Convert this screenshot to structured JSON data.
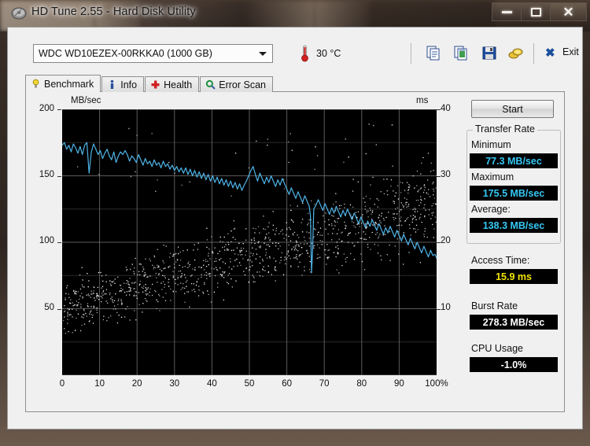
{
  "window": {
    "title": "HD Tune 2.55 - Hard Disk Utility",
    "icon": "hard-disk-icon",
    "controls": {
      "minimize": "–",
      "maximize": "□",
      "close": "✕"
    }
  },
  "toolbar": {
    "drive": "WDC WD10EZEX-00RKKA0 (1000 GB)",
    "temperature": "30 °C",
    "thermometer_icon": "thermometer-icon",
    "icons": [
      {
        "name": "copy-icon"
      },
      {
        "name": "copy-screenshot-icon"
      },
      {
        "name": "save-icon"
      },
      {
        "name": "gold-coins-icon"
      }
    ],
    "exit_label": "Exit",
    "exit_icon": "close-x-icon"
  },
  "tabs": [
    {
      "label": "Benchmark",
      "icon": "bulb-icon",
      "active": true
    },
    {
      "label": "Info",
      "icon": "info-icon",
      "active": false
    },
    {
      "label": "Health",
      "icon": "health-cross-icon",
      "active": false
    },
    {
      "label": "Error Scan",
      "icon": "magnifier-icon",
      "active": false
    }
  ],
  "results": {
    "start_label": "Start",
    "transfer_group": "Transfer Rate",
    "minimum_label": "Minimum",
    "minimum_value": "77.3 MB/sec",
    "maximum_label": "Maximum",
    "maximum_value": "175.5 MB/sec",
    "average_label": "Average:",
    "average_value": "138.3 MB/sec",
    "access_label": "Access Time:",
    "access_value": "15.9 ms",
    "burst_label": "Burst Rate",
    "burst_value": "278.3 MB/sec",
    "cpu_label": "CPU Usage",
    "cpu_value": "-1.0%"
  },
  "colors": {
    "transfer_line": "#4fb4e8",
    "access_dots": "#ffffff",
    "plot_bg": "#000000",
    "grid": "#7a7a7a",
    "value_cyan": "#36c8f4",
    "value_yellow": "#f2e500",
    "value_white": "#ffffff"
  },
  "chart_data": {
    "type": "line",
    "title": "",
    "xlabel": "",
    "ylabel": "MB/sec",
    "y2label": "ms",
    "xlim": [
      0,
      100
    ],
    "ylim": [
      0,
      200
    ],
    "y2lim": [
      0,
      40
    ],
    "grid": true,
    "legend": "none",
    "x_ticks": [
      "0",
      "10",
      "20",
      "30",
      "40",
      "50",
      "60",
      "70",
      "80",
      "90",
      "100%"
    ],
    "y_ticks_left": [
      "200",
      "150",
      "100",
      "50"
    ],
    "y_ticks_right": [
      "40",
      "30",
      "20",
      "10"
    ],
    "series": [
      {
        "name": "Transfer rate",
        "axis": "left",
        "unit": "MB/sec",
        "color": "#4fb4e8",
        "x": [
          0,
          0.6,
          1.2,
          1.8,
          2.4,
          3,
          3.6,
          4.2,
          4.8,
          5.4,
          6,
          6.6,
          7.2,
          7.8,
          8.4,
          9,
          9.6,
          10.2,
          10.8,
          11.4,
          12,
          12.6,
          13.2,
          13.8,
          14.4,
          15,
          15.6,
          16.2,
          16.8,
          17.4,
          18,
          18.6,
          19.2,
          19.8,
          20.4,
          21,
          21.6,
          22.2,
          22.8,
          23.4,
          24,
          24.6,
          25.2,
          25.8,
          26.4,
          27,
          27.6,
          28.2,
          28.8,
          29.4,
          30,
          30.6,
          31.2,
          31.8,
          32.4,
          33,
          33.6,
          34.2,
          34.8,
          35.4,
          36,
          36.6,
          37.2,
          37.8,
          38.4,
          39,
          39.6,
          40.2,
          40.8,
          41.4,
          42,
          42.6,
          43.2,
          43.8,
          44.4,
          45,
          45.6,
          46.2,
          46.8,
          47.4,
          48,
          48.6,
          49.2,
          49.8,
          50.4,
          51,
          51.6,
          52.2,
          52.8,
          53.4,
          54,
          54.6,
          55.2,
          55.8,
          56.4,
          57,
          57.6,
          58.2,
          58.8,
          59.4,
          60,
          60.6,
          61.2,
          61.8,
          62.4,
          63,
          63.6,
          64.2,
          64.8,
          65.4,
          66,
          66.3,
          66.6,
          66.9,
          67.2,
          67.8,
          68.4,
          69,
          69.6,
          70.2,
          70.8,
          71.4,
          72,
          72.6,
          73.2,
          73.8,
          74.4,
          75,
          75.6,
          76.2,
          76.8,
          77.4,
          78,
          78.6,
          79.2,
          79.8,
          80.4,
          81,
          81.6,
          82.2,
          82.8,
          83.4,
          84,
          84.6,
          85.2,
          85.8,
          86.4,
          87,
          87.6,
          88.2,
          88.8,
          89.4,
          90,
          90.6,
          91.2,
          91.8,
          92.4,
          93,
          93.6,
          94.2,
          94.8,
          95.4,
          96,
          96.6,
          97.2,
          97.8,
          98.4,
          99,
          99.6,
          100
        ],
        "y": [
          173,
          175,
          170,
          173,
          168,
          174,
          171,
          167,
          172,
          166,
          173,
          175,
          152,
          168,
          174,
          170,
          166,
          169,
          163,
          167,
          170,
          165,
          162,
          168,
          160,
          165,
          168,
          166,
          169,
          166,
          161,
          165,
          163,
          160,
          166,
          162,
          158,
          163,
          159,
          161,
          157,
          162,
          158,
          160,
          156,
          161,
          157,
          159,
          155,
          158,
          154,
          157,
          153,
          156,
          152,
          156,
          151,
          155,
          150,
          154,
          149,
          153,
          148,
          152,
          147,
          151,
          146,
          150,
          145,
          149,
          144,
          148,
          143,
          147,
          142,
          146,
          141,
          145,
          140,
          144,
          139,
          143,
          146,
          150,
          154,
          157,
          151,
          146,
          152,
          148,
          144,
          149,
          145,
          150,
          146,
          142,
          147,
          143,
          148,
          144,
          140,
          136,
          141,
          137,
          133,
          138,
          134,
          130,
          135,
          131,
          127,
          120,
          77,
          95,
          125,
          128,
          132,
          128,
          124,
          129,
          125,
          121,
          126,
          122,
          127,
          123,
          119,
          124,
          120,
          125,
          121,
          117,
          122,
          118,
          114,
          119,
          115,
          111,
          116,
          112,
          117,
          113,
          109,
          114,
          110,
          106,
          111,
          107,
          112,
          108,
          104,
          109,
          105,
          101,
          106,
          102,
          98,
          103,
          99,
          95,
          100,
          96,
          92,
          97,
          93,
          89,
          94,
          90,
          91,
          88,
          90
        ]
      },
      {
        "name": "Access time",
        "axis": "right",
        "unit": "ms",
        "color": "#ffffff",
        "note": "scatter cloud rising from about 10 ms at 0% to about 26 ms at 100%",
        "average": 15.9
      }
    ]
  }
}
